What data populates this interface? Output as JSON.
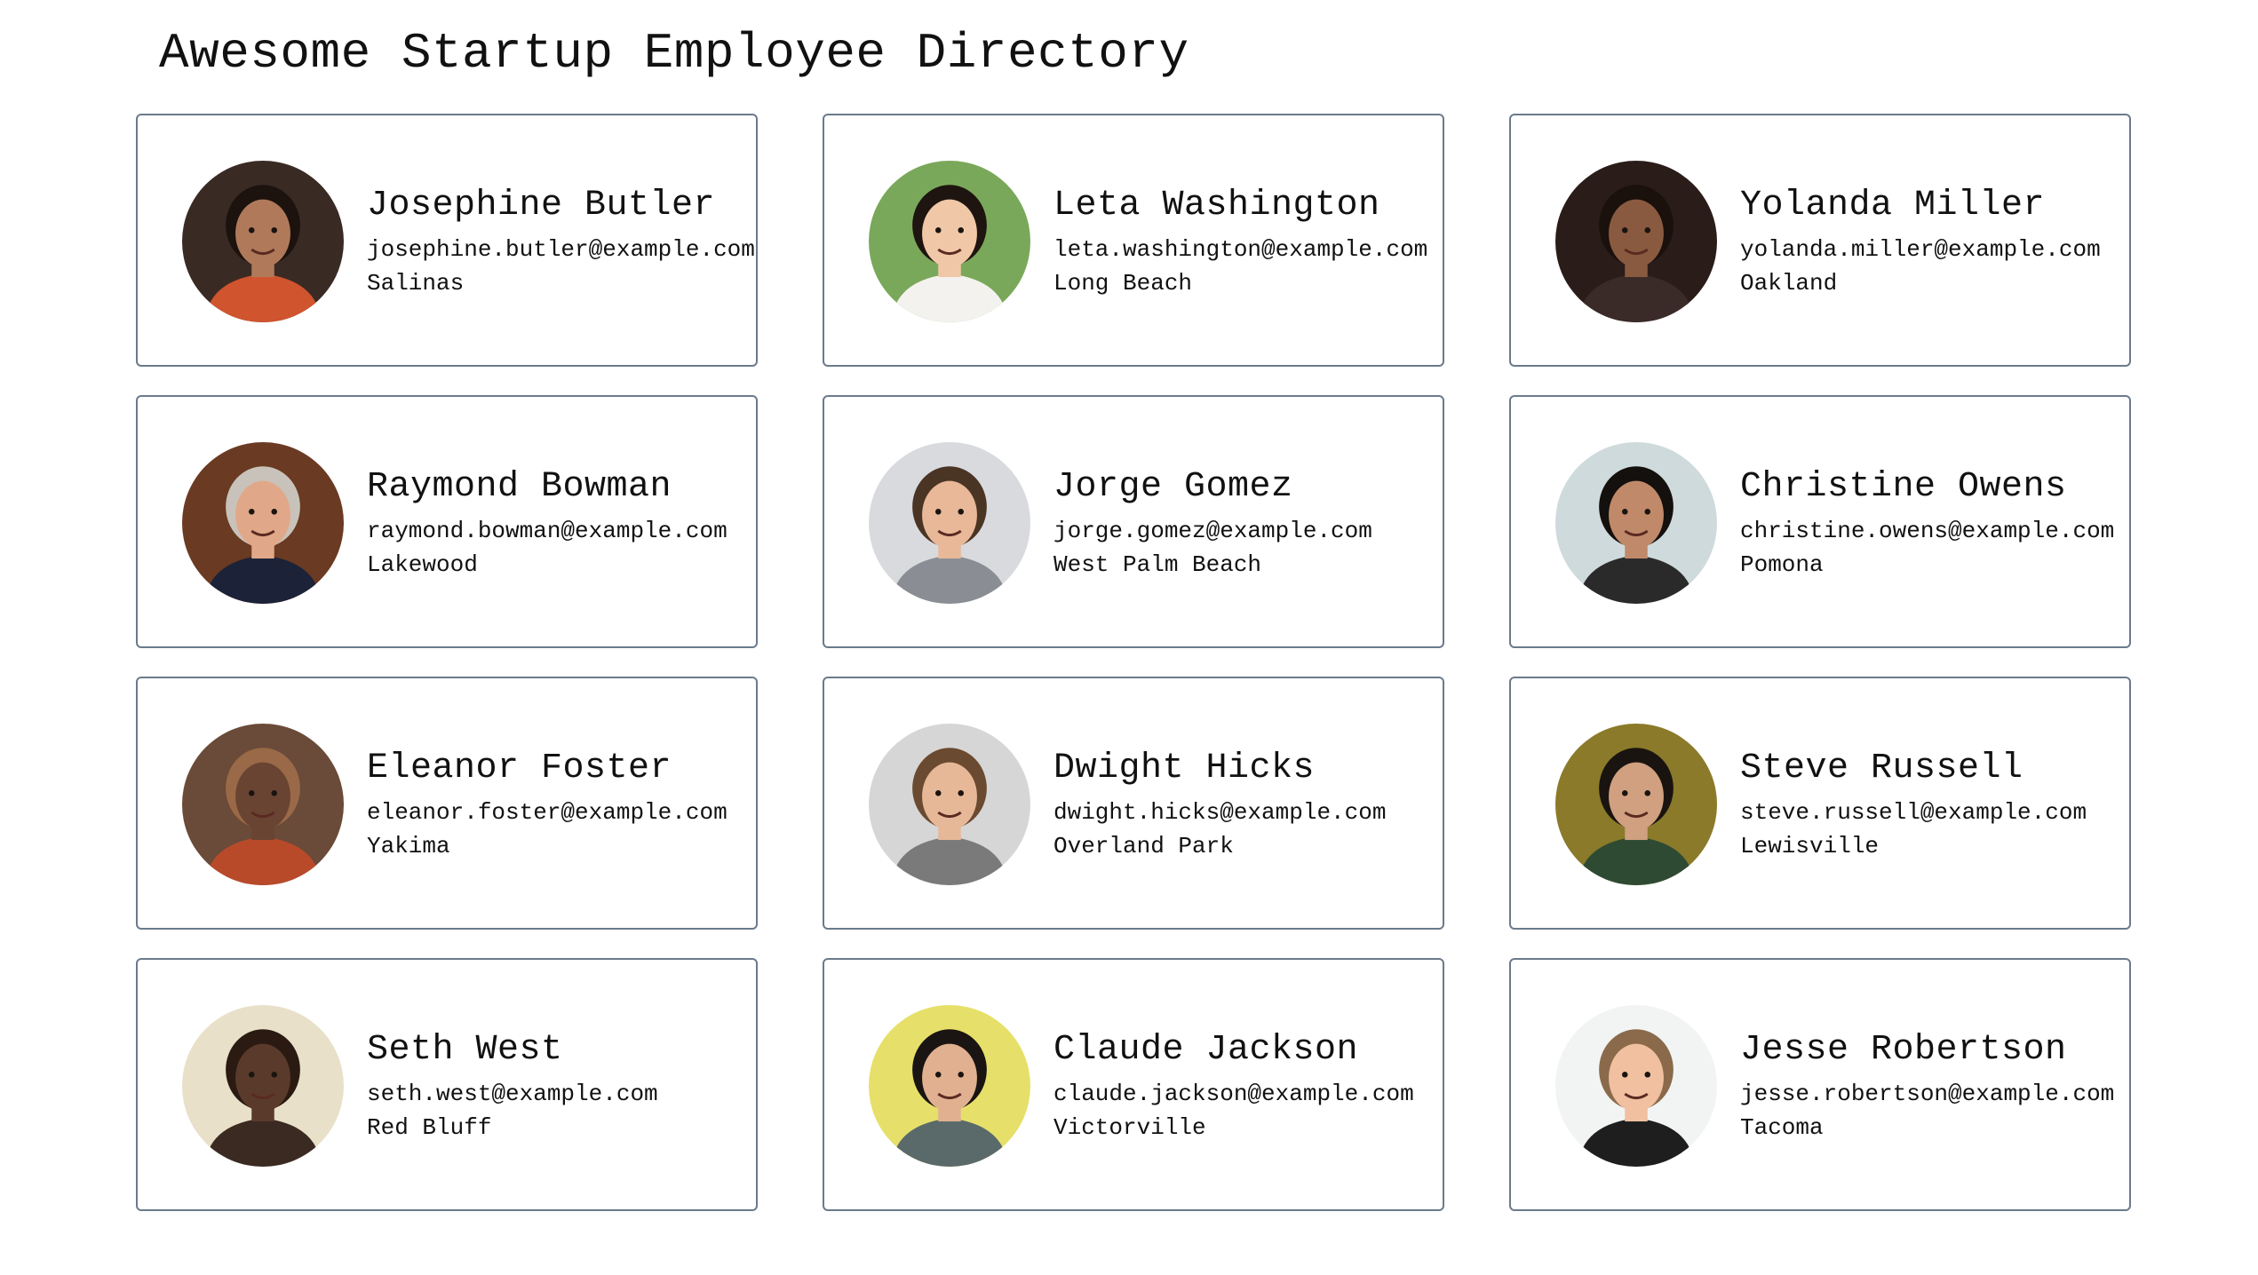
{
  "page": {
    "title": "Awesome Startup Employee Directory"
  },
  "employees": [
    {
      "name": "Josephine Butler",
      "email": "josephine.butler@example.com",
      "city": "Salinas",
      "avatar": {
        "icon": "person-photo",
        "bg": "#3a2a24",
        "skin": "#b07a5a",
        "hair": "#1c120e",
        "shirt": "#d0542e"
      }
    },
    {
      "name": "Leta Washington",
      "email": "leta.washington@example.com",
      "city": "Long Beach",
      "avatar": {
        "icon": "person-photo",
        "bg": "#7aa85a",
        "skin": "#f0c8a8",
        "hair": "#1e1410",
        "shirt": "#f4f2ee"
      }
    },
    {
      "name": "Yolanda Miller",
      "email": "yolanda.miller@example.com",
      "city": "Oakland",
      "avatar": {
        "icon": "person-photo",
        "bg": "#2a1c18",
        "skin": "#8a5a40",
        "hair": "#1a100c",
        "shirt": "#3a2a28"
      }
    },
    {
      "name": "Raymond Bowman",
      "email": "raymond.bowman@example.com",
      "city": "Lakewood",
      "avatar": {
        "icon": "person-photo",
        "bg": "#6a3a22",
        "skin": "#e0a888",
        "hair": "#c8c2ba",
        "shirt": "#1c2238"
      }
    },
    {
      "name": "Jorge Gomez",
      "email": "jorge.gomez@example.com",
      "city": "West Palm Beach",
      "avatar": {
        "icon": "person-photo",
        "bg": "#d8dade",
        "skin": "#e8b898",
        "hair": "#4a3424",
        "shirt": "#8a8e94"
      }
    },
    {
      "name": "Christine Owens",
      "email": "christine.owens@example.com",
      "city": "Pomona",
      "avatar": {
        "icon": "person-photo",
        "bg": "#cfdadc",
        "skin": "#c08a6a",
        "hair": "#14100e",
        "shirt": "#2a2a2a"
      }
    },
    {
      "name": "Eleanor Foster",
      "email": "eleanor.foster@example.com",
      "city": "Yakima",
      "avatar": {
        "icon": "person-photo",
        "bg": "#6a4a38",
        "skin": "#6a4432",
        "hair": "#9a6a48",
        "shirt": "#b84a2a"
      }
    },
    {
      "name": "Dwight Hicks",
      "email": "dwight.hicks@example.com",
      "city": "Overland Park",
      "avatar": {
        "icon": "person-photo",
        "bg": "#d6d6d6",
        "skin": "#e6b898",
        "hair": "#6a4a30",
        "shirt": "#7a7a7a"
      }
    },
    {
      "name": "Steve Russell",
      "email": "steve.russell@example.com",
      "city": "Lewisville",
      "avatar": {
        "icon": "person-photo",
        "bg": "#8a7a2a",
        "skin": "#d0a080",
        "hair": "#1a1410",
        "shirt": "#2e4a32"
      }
    },
    {
      "name": "Seth West",
      "email": "seth.west@example.com",
      "city": "Red Bluff",
      "avatar": {
        "icon": "person-photo",
        "bg": "#e8e0c8",
        "skin": "#5a3a2a",
        "hair": "#2a1a12",
        "shirt": "#3a2a22"
      }
    },
    {
      "name": "Claude Jackson",
      "email": "claude.jackson@example.com",
      "city": "Victorville",
      "avatar": {
        "icon": "person-photo",
        "bg": "#e6e06a",
        "skin": "#e0b090",
        "hair": "#1a1412",
        "shirt": "#5a6a6a"
      }
    },
    {
      "name": "Jesse Robertson",
      "email": "jesse.robertson@example.com",
      "city": "Tacoma",
      "avatar": {
        "icon": "person-photo",
        "bg": "#f2f4f4",
        "skin": "#f0c0a0",
        "hair": "#8a6a4a",
        "shirt": "#1e1e1e"
      }
    }
  ],
  "colors": {
    "card_border": "#6b7a8c",
    "text": "#111111",
    "background": "#ffffff"
  }
}
